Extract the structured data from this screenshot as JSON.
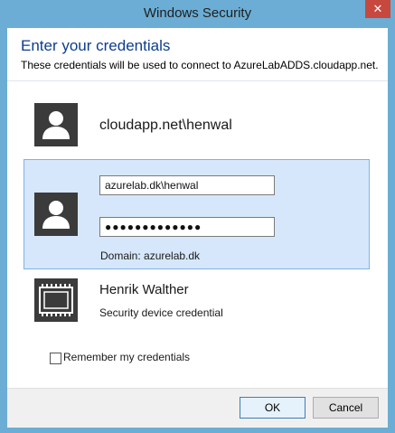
{
  "window": {
    "title": "Windows Security",
    "close_label": "✕"
  },
  "header": {
    "heading": "Enter your credentials",
    "subheading": "These credentials will be used to connect to AzureLabADDS.cloudapp.net."
  },
  "accounts": [
    {
      "name": "cloudapp.net\\henwal"
    }
  ],
  "selected": {
    "username_value": "azurelab.dk\\henwal",
    "password_value": "●●●●●●●●●●●●●",
    "domain_text": "Domain: azurelab.dk"
  },
  "smartcard": {
    "name": "Henrik Walther",
    "subtitle": "Security device credential"
  },
  "remember": {
    "label": "Remember my credentials",
    "checked": false
  },
  "buttons": {
    "ok": "OK",
    "cancel": "Cancel"
  },
  "colors": {
    "frame": "#6badd4",
    "heading": "#0d3d8f",
    "close": "#c7483e",
    "selected_bg": "#d6e7fb"
  }
}
